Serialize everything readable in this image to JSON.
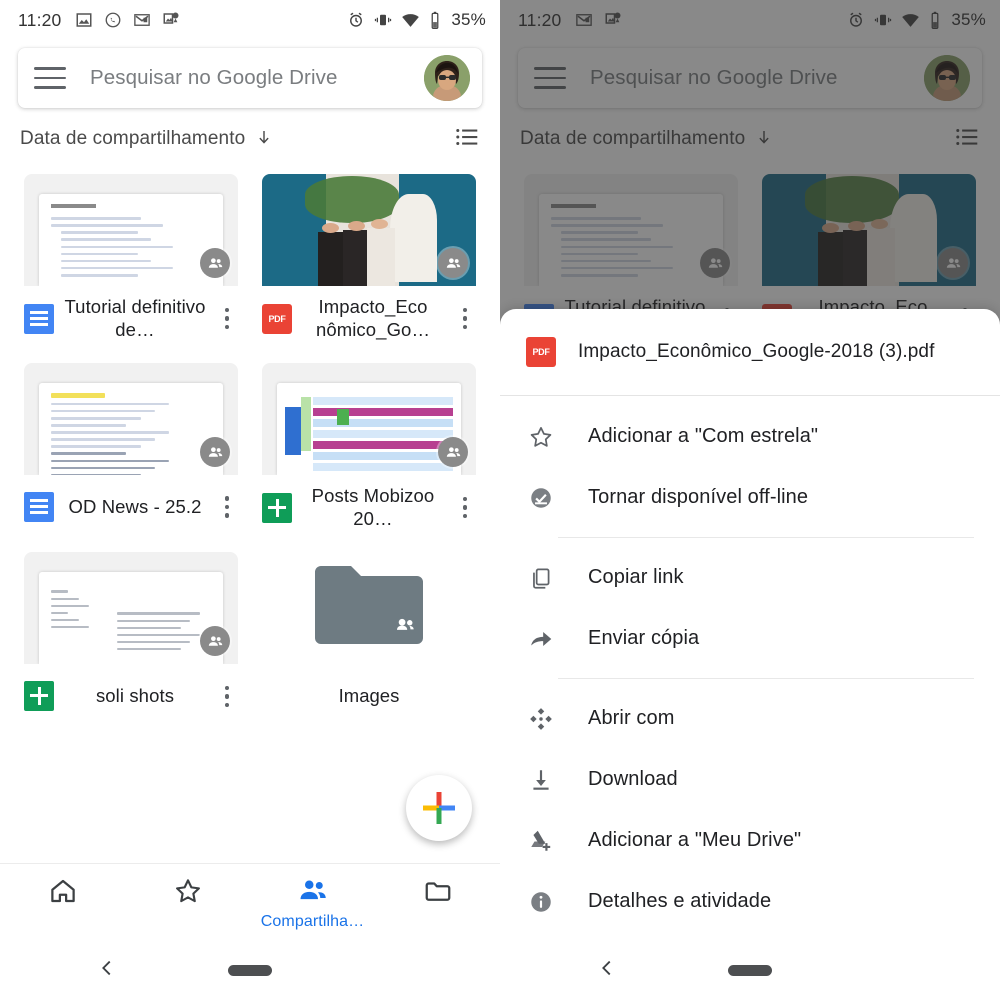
{
  "status_bar": {
    "time": "11:20",
    "left_icons": [
      "photos-icon",
      "whatsapp-icon",
      "gmail-icon",
      "maps-icon"
    ],
    "right_icons": [
      "alarm-icon",
      "vibrate-icon",
      "wifi-icon",
      "battery-icon"
    ],
    "battery_text": "35%"
  },
  "search": {
    "placeholder": "Pesquisar no Google Drive",
    "menu_icon": "hamburger-icon",
    "avatar_icon": "avatar"
  },
  "sort": {
    "label": "Data de compartilhamento",
    "direction_icon": "arrow-down-icon",
    "view_icon": "list-view-icon"
  },
  "files": [
    {
      "name": "Tutorial definitivo de…",
      "type": "docs",
      "thumb": "document",
      "shared": true,
      "kind": "file"
    },
    {
      "name": "Impacto_Eco nômico_Go…",
      "type": "pdf",
      "thumb": "photo",
      "shared": true,
      "kind": "file"
    },
    {
      "name": "OD News - 25.2",
      "type": "docs",
      "thumb": "document-highlight",
      "shared": true,
      "kind": "file"
    },
    {
      "name": "Posts Mobizoo 20…",
      "type": "sheets",
      "thumb": "spreadsheet",
      "shared": true,
      "kind": "file"
    },
    {
      "name": "soli shots",
      "type": "sheets",
      "thumb": "document-table",
      "shared": true,
      "kind": "file"
    },
    {
      "name": "Images",
      "type": "folder",
      "thumb": "folder",
      "shared": true,
      "kind": "folder"
    }
  ],
  "fab": {
    "icon": "google-plus-icon",
    "label": "Criar"
  },
  "bottom_nav": [
    {
      "icon": "home-icon",
      "label": "",
      "active": false
    },
    {
      "icon": "star-icon",
      "label": "",
      "active": false
    },
    {
      "icon": "people-icon",
      "label": "Compartilha…",
      "active": true
    },
    {
      "icon": "folder-icon",
      "label": "",
      "active": false
    }
  ],
  "android_nav": {
    "back_icon": "back-chevron-icon",
    "pill": "home-pill"
  },
  "sheet": {
    "file_name": "Impacto_Econômico_Google-2018 (3).pdf",
    "file_type_icon": "pdf-icon",
    "items": [
      {
        "icon": "star-outline-icon",
        "label": "Adicionar a \"Com estrela\"",
        "divider_after": false
      },
      {
        "icon": "offline-check-icon",
        "label": "Tornar disponível off-line",
        "divider_after": true
      },
      {
        "icon": "copy-link-icon",
        "label": "Copiar link",
        "divider_after": false
      },
      {
        "icon": "send-copy-icon",
        "label": "Enviar cópia",
        "divider_after": true
      },
      {
        "icon": "open-with-icon",
        "label": "Abrir com",
        "divider_after": false
      },
      {
        "icon": "download-icon",
        "label": "Download",
        "divider_after": false
      },
      {
        "icon": "add-to-drive-icon",
        "label": "Adicionar a \"Meu Drive\"",
        "divider_after": false
      },
      {
        "icon": "details-info-icon",
        "label": "Detalhes e atividade",
        "divider_after": false
      }
    ]
  },
  "colors": {
    "accent_blue": "#1a73e8",
    "pdf_red": "#ea4335",
    "docs_blue": "#4285f4",
    "sheets_green": "#0f9d58",
    "folder_gray": "#6e7b82",
    "google_red": "#ea4335",
    "google_yellow": "#fbbc04",
    "google_green": "#34a853"
  }
}
